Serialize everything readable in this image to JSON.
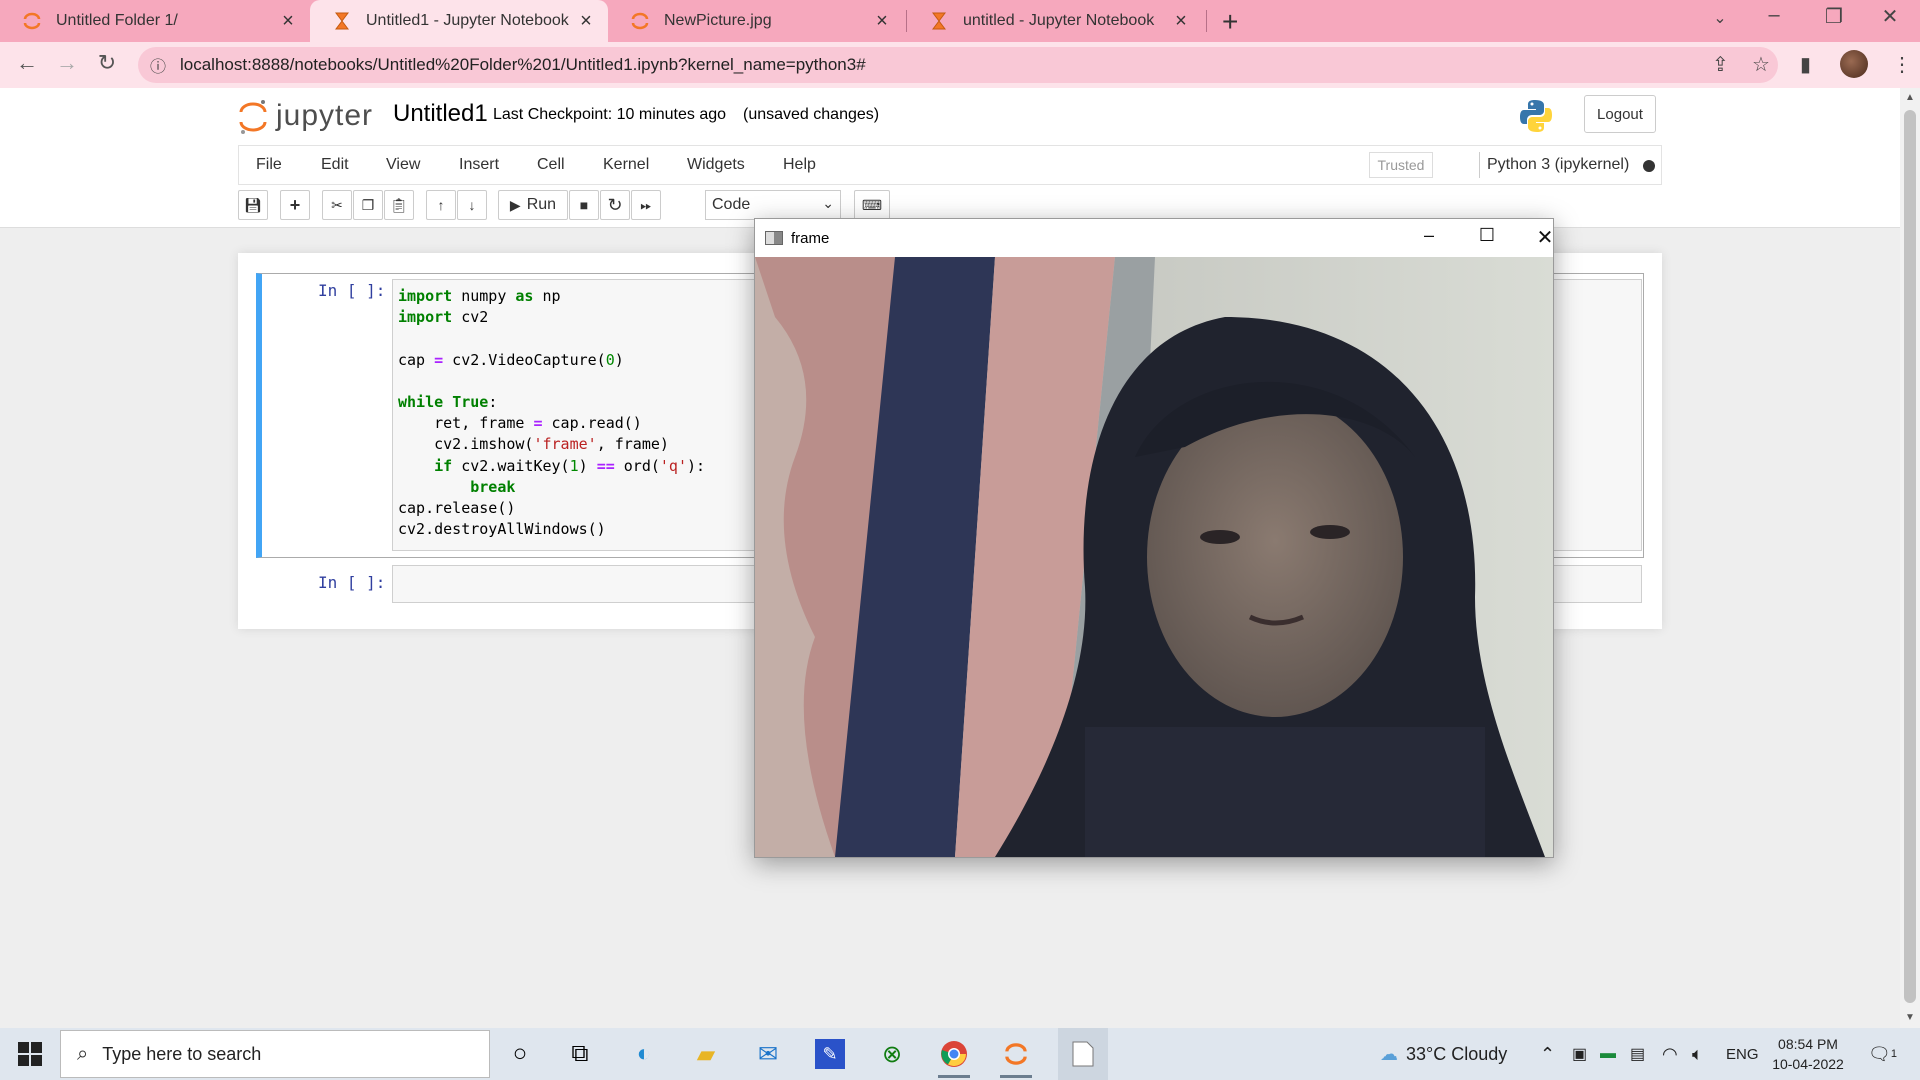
{
  "browser": {
    "tabs": [
      {
        "label": "Untitled Folder 1/",
        "icon": "jupyter-icon",
        "active": false
      },
      {
        "label": "Untitled1 - Jupyter Notebook",
        "icon": "hourglass-icon",
        "active": true
      },
      {
        "label": "NewPicture.jpg",
        "icon": "jupyter-icon",
        "active": false
      },
      {
        "label": "untitled - Jupyter Notebook",
        "icon": "hourglass-icon",
        "active": false
      }
    ],
    "url": "localhost:8888/notebooks/Untitled%20Folder%201/Untitled1.ipynb?kernel_name=python3#",
    "accent": "#f6a8bd"
  },
  "jupyter": {
    "wordmark": "jupyter",
    "notebook_name": "Untitled1",
    "checkpoint": "Last Checkpoint: 10 minutes ago",
    "unsaved": "(unsaved changes)",
    "logout": "Logout",
    "menu": [
      "File",
      "Edit",
      "View",
      "Insert",
      "Cell",
      "Kernel",
      "Widgets",
      "Help"
    ],
    "trusted": "Trusted",
    "kernel": "Python 3 (ipykernel)",
    "toolbar": {
      "run_label": "Run",
      "cell_type": "Code"
    },
    "cells": [
      {
        "prompt": "In [ ]:",
        "code": [
          "import numpy as np",
          "import cv2",
          "",
          "cap = cv2.VideoCapture(0)",
          "",
          "while True:",
          "    ret, frame = cap.read()",
          "    cv2.imshow('frame', frame)",
          "    if cv2.waitKey(1) == ord('q'):",
          "        break",
          "cap.release()",
          "cv2.destroyAllWindows()"
        ]
      },
      {
        "prompt": "In [ ]:",
        "code": []
      }
    ]
  },
  "cv_window": {
    "title": "frame"
  },
  "taskbar": {
    "search_placeholder": "Type here to search",
    "weather": "33°C  Cloudy",
    "language": "ENG",
    "time": "08:54 PM",
    "date": "10-04-2022",
    "notification_count": "1"
  }
}
